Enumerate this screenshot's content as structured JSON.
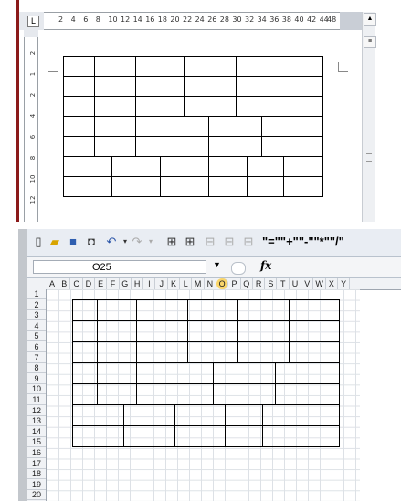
{
  "word": {
    "tab_selector": "L",
    "ruler_numbers": [
      "2",
      "4",
      "6",
      "8",
      "10",
      "12",
      "14",
      "16",
      "18",
      "20",
      "22",
      "24",
      "26",
      "28",
      "30",
      "32",
      "34",
      "36",
      "38",
      "40",
      "42",
      "44",
      "48"
    ],
    "vertical_ruler": [
      "2",
      "1",
      "2",
      "4",
      "6",
      "8",
      "10",
      "12"
    ]
  },
  "excel": {
    "toolbar_icons": [
      "new-icon",
      "open-icon",
      "save-icon",
      "print-preview-icon",
      "undo-icon",
      "redo-icon",
      "borders-icon",
      "all-borders-icon",
      "grid-icon",
      "merge-icon",
      "split-icon"
    ],
    "toolbar_symbols": "\"=\"\"+\"\"-\"\"*\"\"/\"",
    "name_box": "O25",
    "name_box_dropdown": "▼",
    "fx_label": "fx",
    "columns": [
      "A",
      "B",
      "C",
      "D",
      "E",
      "F",
      "G",
      "H",
      "I",
      "J",
      "K",
      "L",
      "M",
      "N",
      "O",
      "P",
      "Q",
      "R",
      "S",
      "T",
      "U",
      "V",
      "W",
      "X",
      "Y"
    ],
    "selected_column": "O",
    "rows": [
      "1",
      "2",
      "3",
      "4",
      "5",
      "6",
      "7",
      "8",
      "9",
      "10",
      "11",
      "12",
      "13",
      "14",
      "15",
      "16",
      "17",
      "18",
      "19",
      "20"
    ]
  }
}
